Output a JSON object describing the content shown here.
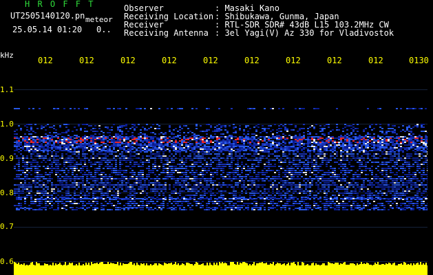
{
  "header": {
    "app_title": "H R O F F T",
    "file_name": "UT2505140120.pn",
    "meteor_tag": "meteor",
    "date_time": "25.05.14 01:20",
    "counter": "0..",
    "meta": [
      {
        "label": "Observer",
        "value": ": Masaki Kano"
      },
      {
        "label": "Receiving Location",
        "value": ": Shibukawa, Gunma, Japan"
      },
      {
        "label": "Receiver",
        "value": ": RTL-SDR SDR# 43dB L15 103.2MHz CW"
      },
      {
        "label": "Receiving Antenna",
        "value": ": 3el Yagi(V) Az 330 for Vladivostok"
      }
    ]
  },
  "spectrogram": {
    "unit": "kHz",
    "time_ticks": [
      "012",
      "012",
      "012",
      "012",
      "012",
      "012",
      "012",
      "012",
      "012",
      "0130"
    ],
    "freq_labels": [
      "1.1",
      "1.0",
      "0.9",
      "0.8",
      "0.7",
      "0.6"
    ],
    "colors": {
      "background": "#000000",
      "noise_low": "#0a1f9e",
      "noise_mid": "#2b62ff",
      "noise_high": "#ffffff",
      "hot": "#ff2a2a",
      "level_bar": "#ffff00",
      "tick_text": "#ffff00"
    }
  }
}
